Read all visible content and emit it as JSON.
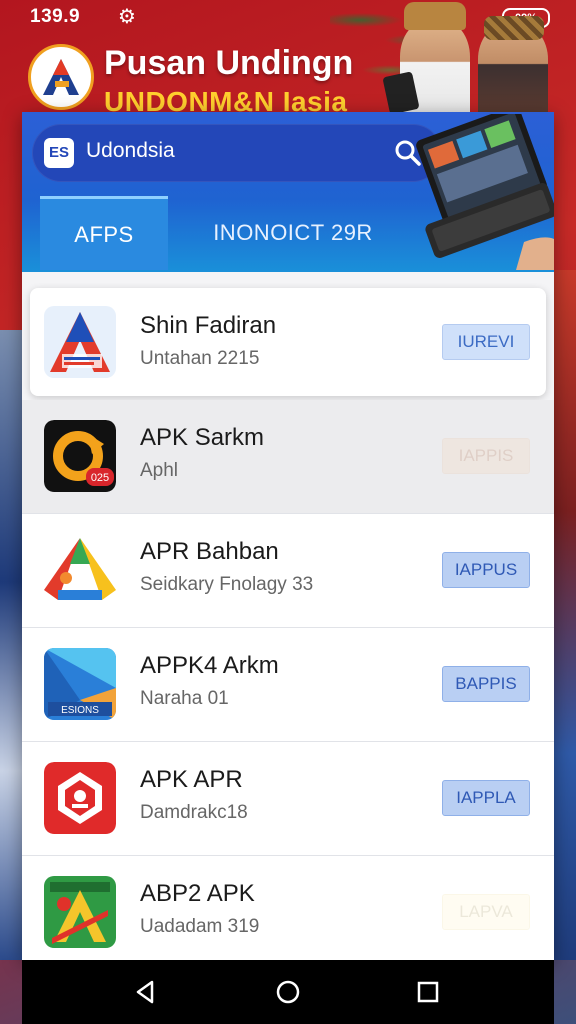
{
  "status_bar": {
    "time": "139.9",
    "battery": "09%"
  },
  "hero": {
    "title": "Pusan Undingn",
    "subtitle": "UNDONM&N Iasia"
  },
  "app": {
    "search": {
      "logo": "ES",
      "text": "Udondsia"
    },
    "tabs": [
      {
        "label": "AFPS",
        "active": true
      },
      {
        "label": "INONOICT 29R",
        "active": false
      }
    ],
    "items": [
      {
        "title": "Shin Fadiran",
        "subtitle": "Untahan 2215",
        "button": "IUREVI",
        "icon": "a-red-blue-icon"
      },
      {
        "title": "APK Sarkm",
        "subtitle": "Aphl",
        "button": "IAPPIS",
        "icon": "black-orange-a-icon"
      },
      {
        "title": "APR Bahban",
        "subtitle": "Seidkary Fnolagy 33",
        "button": "IAPPUS",
        "icon": "multicolor-a-icon"
      },
      {
        "title": "APPK4 Arkm",
        "subtitle": "Naraha 01",
        "button": "BAPPIS",
        "icon": "blue-folded-icon"
      },
      {
        "title": "APK APR",
        "subtitle": "Damdrakc18",
        "button": "IAPPLA",
        "icon": "red-badge-icon"
      },
      {
        "title": "ABP2 APK",
        "subtitle": "Uadadam 319",
        "button": "LAPVA",
        "icon": "green-a-icon"
      }
    ]
  },
  "colors": {
    "header_blue": "#1f63d1",
    "button_blue": "#b9cff3",
    "hero_red": "#c72a27",
    "hero_yellow": "#ffcf2e"
  }
}
